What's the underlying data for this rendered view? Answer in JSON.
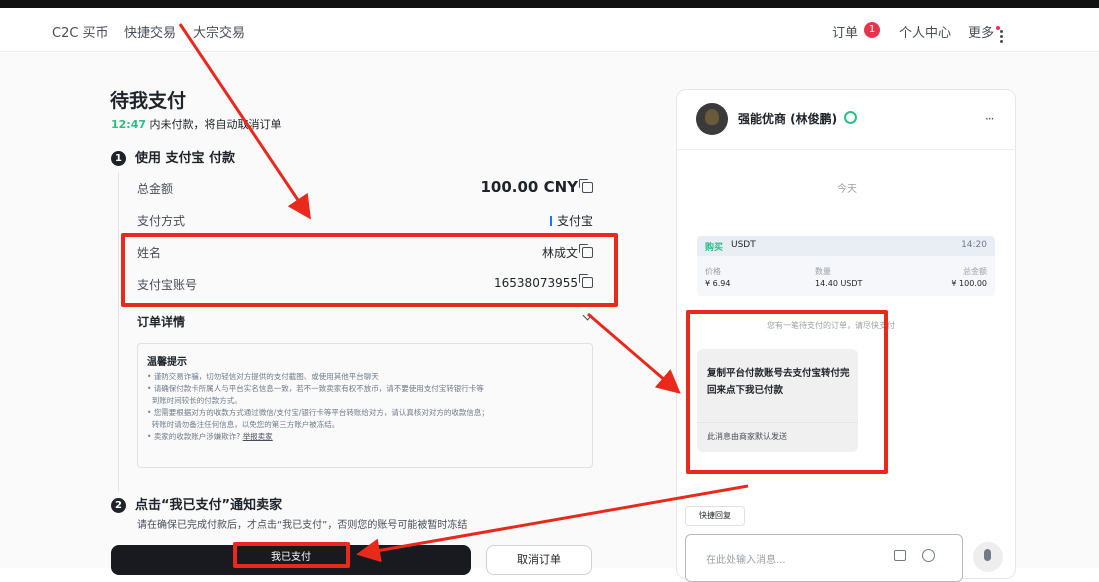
{
  "nav": {
    "items": [
      "C2C 买币",
      "快捷交易",
      "大宗交易"
    ],
    "orders_label": "订单",
    "orders_badge": "1",
    "user_center": "个人中心",
    "more": "更多"
  },
  "order": {
    "title": "待我支付",
    "countdown_time": "12:47",
    "countdown_text": "内未付款，将自动取消订单",
    "step1_num": "1",
    "step1_title": "使用 支付宝 付款",
    "rows": [
      {
        "label": "总金额",
        "value": "100.00 CNY"
      },
      {
        "label": "支付方式",
        "value": "支付宝"
      },
      {
        "label": "姓名",
        "value": "林成文"
      },
      {
        "label": "支付宝账号",
        "value": "16538073955"
      }
    ],
    "details_label": "订单详情",
    "tips_title": "温馨提示",
    "tips": [
      "谨防交易诈骗，切勿轻信对方提供的支付截图、或使用其他平台聊天",
      "请确保付款卡所属人与平台实名信息一致，若不一致卖家有权不放币，请不要使用支付宝转银行卡等",
      "到账时间较长的付款方式。",
      "您需要根据对方的收款方式通过微信/支付宝/银行卡等平台转账给对方，请认真核对对方的收款信息；",
      "转账时请勿备注任何信息，以免您的第三方账户被冻结。",
      "卖家的收款账户涉嫌欺诈?"
    ],
    "report_link": "举报卖家",
    "step2_num": "2",
    "step2_title": "点击“我已支付”通知卖家",
    "step2_desc": "请在确保已完成付款后，才点击“我已支付”，否则您的账号可能被暂时冻结",
    "pay_button": "我已支付",
    "cancel_button": "取消订单"
  },
  "chat": {
    "merchant_name": "强能优商 (林俊鹏)",
    "more_icon": "···",
    "date": "今天",
    "order_card": {
      "side": "购买",
      "coin": "USDT",
      "time": "14:20",
      "labels": [
        "价格",
        "数量",
        "总金额"
      ],
      "values": [
        "¥ 6.94",
        "14.40 USDT",
        "¥ 100.00"
      ]
    },
    "pending_note": "您有一笔待支付的订单，请尽快支付",
    "message": "复制平台付款账号去支付宝转付完回来点下我已付款",
    "auto_note": "此消息由商家默认发送",
    "quick_reply": "快捷回复",
    "input_placeholder": "在此处输入消息..."
  },
  "colors": {
    "annotation_red": "#e8291c",
    "accent_green": "#2ebd85",
    "badge_red": "#e8334a",
    "dark_button": "#181a20"
  }
}
